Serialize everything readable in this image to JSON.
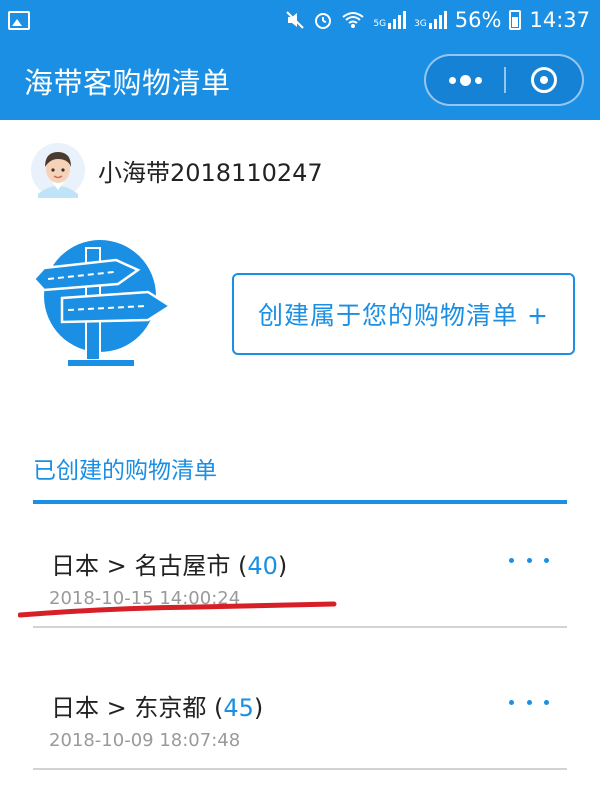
{
  "status_bar": {
    "battery": "56%",
    "time": "14:37",
    "network": "5G",
    "network2": "3G"
  },
  "titlebar": {
    "title": "海带客购物清单"
  },
  "user": {
    "name": "小海带2018110247"
  },
  "create": {
    "label": "创建属于您的购物清单 +"
  },
  "section": {
    "title": "已创建的购物清单"
  },
  "lists": [
    {
      "prefix": "日本 > 名古屋市 (",
      "count": "40",
      "suffix": ")",
      "date": "2018-10-15 14:00:24"
    },
    {
      "prefix": "日本 > 东京都 (",
      "count": "45",
      "suffix": ")",
      "date": "2018-10-09 18:07:48"
    }
  ],
  "colors": {
    "primary": "#1a8fe3",
    "annotation": "#d61f26",
    "date": "#9a9a9a",
    "divider": "#d3d3d3"
  }
}
